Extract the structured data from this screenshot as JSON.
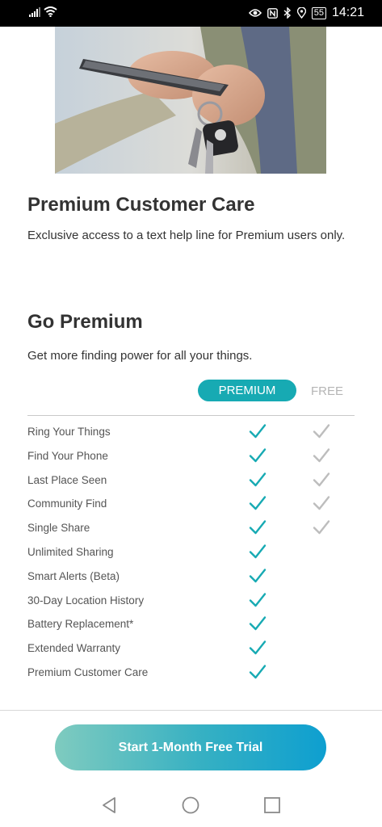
{
  "status_bar": {
    "time": "14:21",
    "battery": "55",
    "icons": [
      "signal-icon",
      "wifi-icon",
      "eye-icon",
      "nfc-icon",
      "bluetooth-icon",
      "location-icon",
      "battery-icon"
    ]
  },
  "hero": {
    "icon": "hand-phone-keys-photo"
  },
  "care": {
    "title": "Premium Customer Care",
    "text": "Exclusive access to a text help line for Premium users only."
  },
  "premium": {
    "title": "Go Premium",
    "subtitle": "Get more finding power for all your things.",
    "premium_label": "PREMIUM",
    "free_label": "FREE"
  },
  "features": [
    {
      "label": "Ring Your Things",
      "premium": true,
      "free": true
    },
    {
      "label": "Find Your Phone",
      "premium": true,
      "free": true
    },
    {
      "label": "Last Place Seen",
      "premium": true,
      "free": true
    },
    {
      "label": "Community Find",
      "premium": true,
      "free": true
    },
    {
      "label": "Single Share",
      "premium": true,
      "free": true
    },
    {
      "label": "Unlimited Sharing",
      "premium": true,
      "free": false
    },
    {
      "label": "Smart Alerts (Beta)",
      "premium": true,
      "free": false
    },
    {
      "label": "30-Day Location History",
      "premium": true,
      "free": false
    },
    {
      "label": "Battery Replacement*",
      "premium": true,
      "free": false
    },
    {
      "label": "Extended Warranty",
      "premium": true,
      "free": false
    },
    {
      "label": "Premium Customer Care",
      "premium": true,
      "free": false
    }
  ],
  "cta": {
    "label": "Start 1-Month Free Trial"
  },
  "colors": {
    "accent": "#17aab3",
    "check_free": "#bdbdbd",
    "text": "#333333"
  }
}
